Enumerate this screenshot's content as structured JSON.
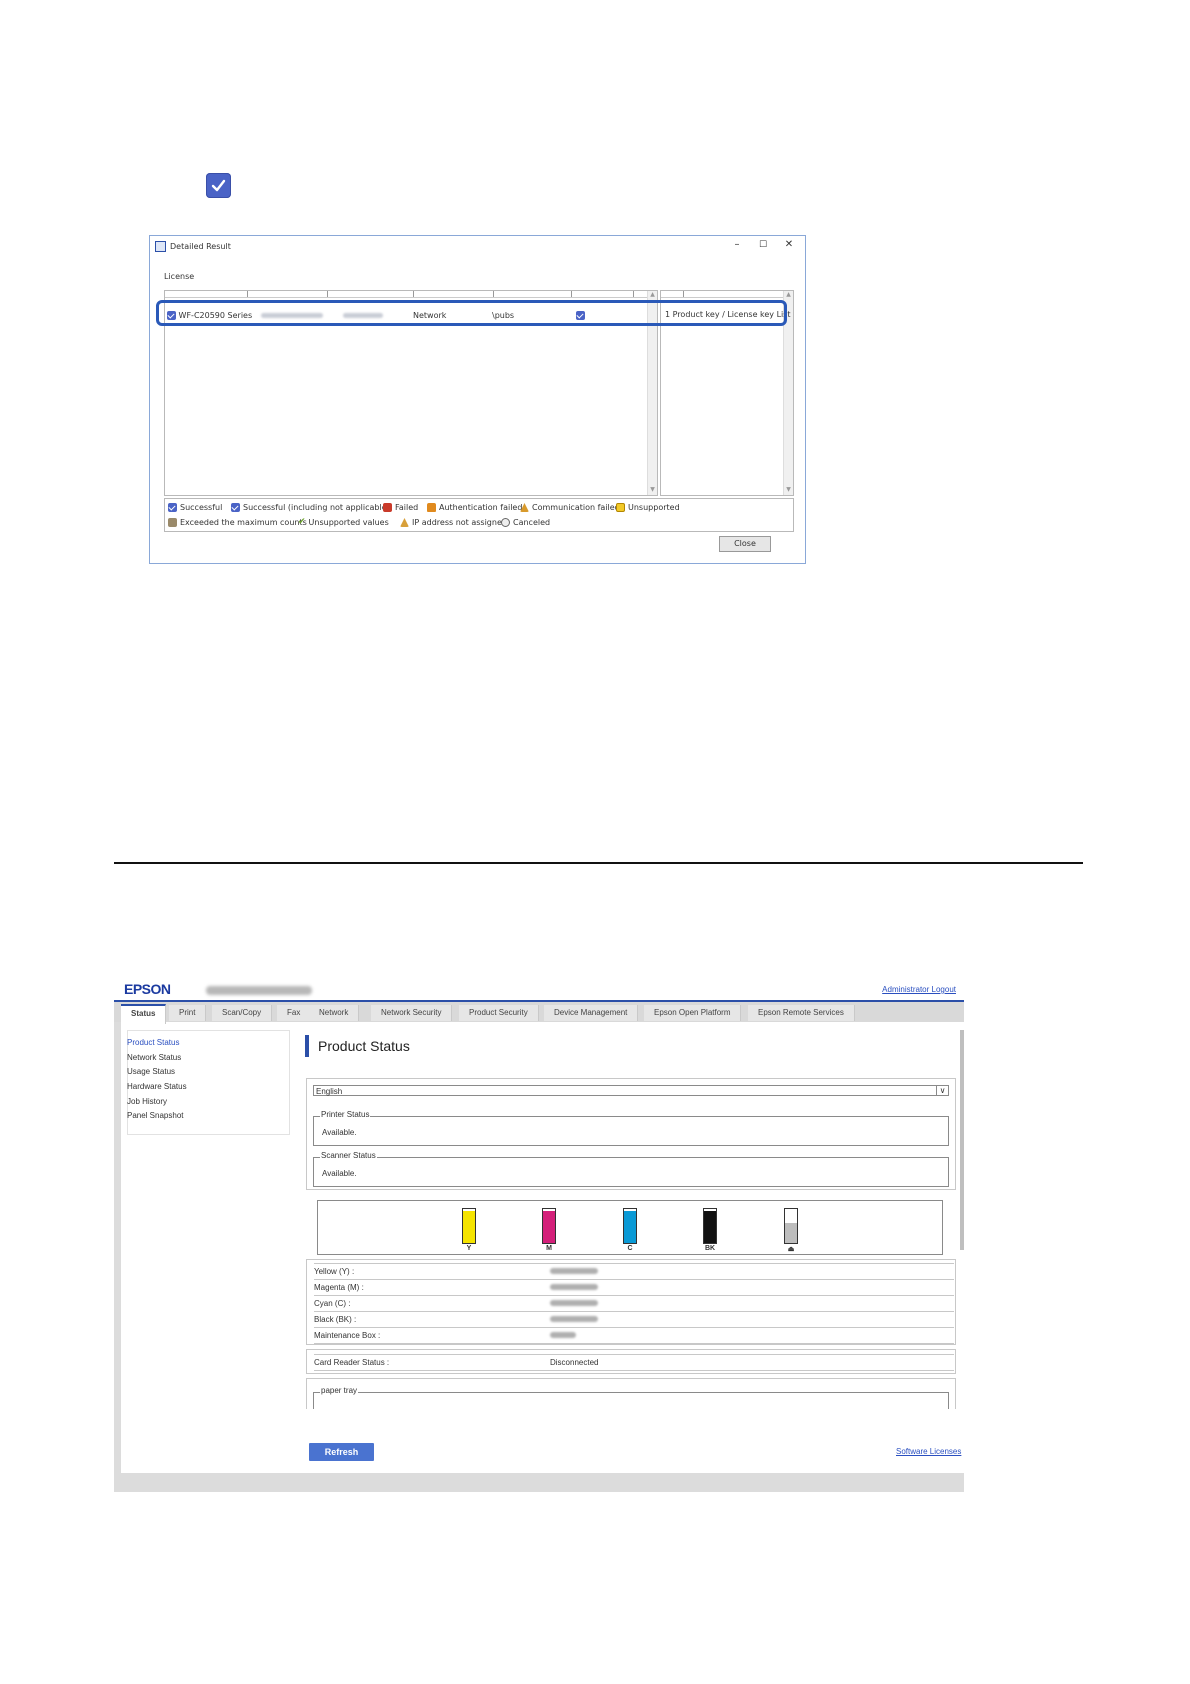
{
  "standalone_checkbox": {
    "icon": "checkmark-icon",
    "color": "#4a63c6"
  },
  "dialog": {
    "title": "Detailed Result",
    "section_label": "License",
    "row": {
      "model": "WF-C20590 Series",
      "connection": "Network",
      "queue": "\\pubs",
      "detail": "1 Product key / License key List"
    },
    "legend": [
      {
        "icon": "success-check-icon",
        "label": "Successful"
      },
      {
        "icon": "success-na-check-icon",
        "label": "Successful (including not applicable)"
      },
      {
        "icon": "failed-icon",
        "label": "Failed"
      },
      {
        "icon": "lock-icon",
        "label": "Authentication failed"
      },
      {
        "icon": "network-icon",
        "label": "Communication failed"
      },
      {
        "icon": "warning-icon",
        "label": "Unsupported"
      },
      {
        "icon": "printer-icon",
        "label": "Exceeded the maximum counts"
      },
      {
        "icon": "check-mark-icon",
        "label": "Unsupported values"
      },
      {
        "icon": "ip-icon",
        "label": "IP address not assigned"
      },
      {
        "icon": "cancel-icon",
        "label": "Canceled"
      }
    ],
    "close_label": "Close",
    "window_controls": {
      "minimize": "–",
      "maximize": "☐",
      "close": "✕"
    }
  },
  "web": {
    "logo": "EPSON",
    "admin_logout": "Administrator Logout",
    "tabs": [
      "Status",
      "Print",
      "Scan/Copy",
      "Fax",
      "Network",
      "Network Security",
      "Product Security",
      "Device Management",
      "Epson Open Platform",
      "Epson Remote Services"
    ],
    "sidebar": [
      "Product Status",
      "Network Status",
      "Usage Status",
      "Hardware Status",
      "Job History",
      "Panel Snapshot"
    ],
    "page_title": "Product Status",
    "language": "English",
    "printer_status_label": "Printer Status",
    "printer_status_value": "Available.",
    "scanner_status_label": "Scanner Status",
    "scanner_status_value": "Available.",
    "inks": [
      {
        "label": "Y",
        "color": "#f5e400",
        "level": 0.95
      },
      {
        "label": "M",
        "color": "#d4207a",
        "level": 0.95
      },
      {
        "label": "C",
        "color": "#0a9ad6",
        "level": 0.95
      },
      {
        "label": "BK",
        "color": "#111111",
        "level": 0.95
      },
      {
        "label": "",
        "color": "#bdbdbd",
        "level": 0.6,
        "icon": "maintenance-box-icon"
      }
    ],
    "consumables": [
      {
        "key": "Yellow (Y) :"
      },
      {
        "key": "Magenta (M) :"
      },
      {
        "key": "Cyan (C) :"
      },
      {
        "key": "Black (BK) :"
      },
      {
        "key": "Maintenance Box :"
      }
    ],
    "card_reader_label": "Card Reader Status :",
    "card_reader_value": "Disconnected",
    "paper_tray_label": "paper tray",
    "refresh_label": "Refresh",
    "software_licenses": "Software Licenses"
  }
}
